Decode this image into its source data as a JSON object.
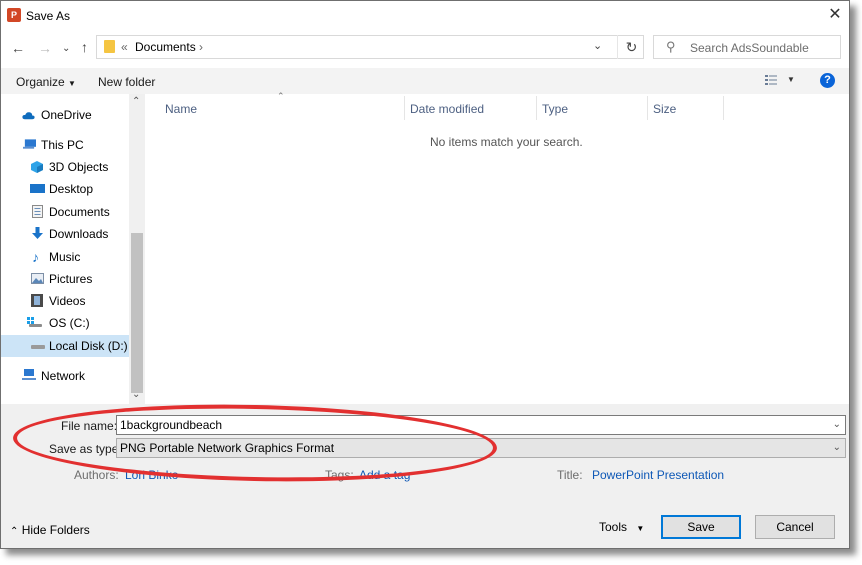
{
  "window": {
    "title": "Save As",
    "app_icon_letter": "P"
  },
  "address_bar": {
    "overflow_chevron": "«",
    "crumb": "Documents",
    "separator": "›",
    "search_placeholder": "Search AdsSoundable"
  },
  "toolbar": {
    "organize_label": "Organize",
    "new_folder_label": "New folder",
    "help_label": "?"
  },
  "nav": {
    "items": [
      {
        "label": "OneDrive",
        "icon": "cloud-icon"
      },
      {
        "label": "This PC",
        "icon": "pc-icon"
      },
      {
        "label": "3D Objects",
        "icon": "cube-icon"
      },
      {
        "label": "Desktop",
        "icon": "desktop-icon"
      },
      {
        "label": "Documents",
        "icon": "document-icon"
      },
      {
        "label": "Downloads",
        "icon": "download-icon"
      },
      {
        "label": "Music",
        "icon": "music-icon"
      },
      {
        "label": "Pictures",
        "icon": "pictures-icon"
      },
      {
        "label": "Videos",
        "icon": "video-icon"
      },
      {
        "label": "OS (C:)",
        "icon": "drive-icon"
      },
      {
        "label": "Local Disk (D:)",
        "icon": "drive-icon",
        "selected": true
      },
      {
        "label": "Network",
        "icon": "network-icon"
      }
    ]
  },
  "columns": {
    "name": "Name",
    "date_modified": "Date modified",
    "type": "Type",
    "size": "Size"
  },
  "content": {
    "empty_message": "No items match your search."
  },
  "form": {
    "file_name_label": "File name:",
    "file_name_value": "1backgroundbeach",
    "save_type_label": "Save as type:",
    "save_type_value": "PNG Portable Network Graphics Format",
    "authors_label": "Authors:",
    "authors_value": "Lori Binko",
    "tags_label": "Tags:",
    "tags_value": "Add a tag",
    "title_label": "Title:",
    "title_value": "PowerPoint Presentation"
  },
  "footer": {
    "hide_folders_label": "Hide Folders",
    "tools_label": "Tools",
    "save_label": "Save",
    "cancel_label": "Cancel"
  },
  "colors": {
    "accent": "#0078d7",
    "annotation": "#e23030",
    "link": "#0e58b6"
  }
}
